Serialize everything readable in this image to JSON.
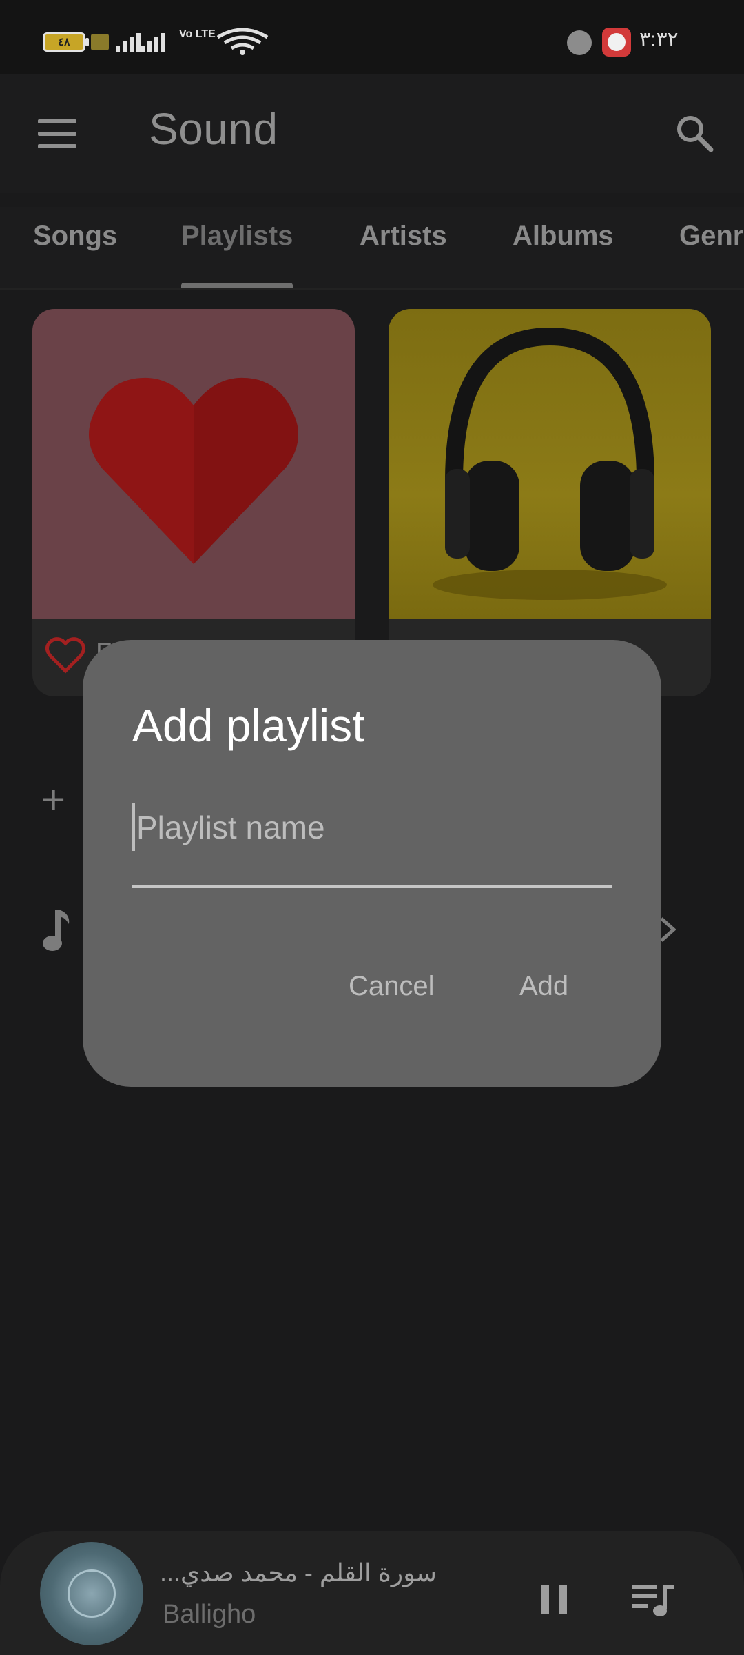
{
  "status_bar": {
    "battery": "٤٨",
    "network_label": "Vo LTE",
    "time": "٣:٣٢"
  },
  "app_bar": {
    "title": "Sound"
  },
  "tabs": [
    {
      "label": "Songs",
      "active": false
    },
    {
      "label": "Playlists",
      "active": true
    },
    {
      "label": "Artists",
      "active": false
    },
    {
      "label": "Albums",
      "active": false
    },
    {
      "label": "Genres",
      "active": false
    }
  ],
  "cards": {
    "first_label_stub": "F"
  },
  "dialog": {
    "title": "Add playlist",
    "input_placeholder": "Playlist name",
    "input_value": "",
    "cancel_label": "Cancel",
    "add_label": "Add"
  },
  "player": {
    "title": "...سورة القلم - محمد صدي",
    "artist": "Balligho"
  },
  "icons": {
    "menu": "menu-icon",
    "search": "search-icon",
    "favorite": "heart-outline-icon",
    "add": "plus-icon",
    "music": "music-note-icon",
    "chevron": "chevron-right-icon",
    "pause": "pause-icon",
    "queue": "queue-music-icon"
  },
  "colors": {
    "background": "#1a1a1b",
    "dialog": "#636363",
    "heart_accent": "#c62828"
  }
}
